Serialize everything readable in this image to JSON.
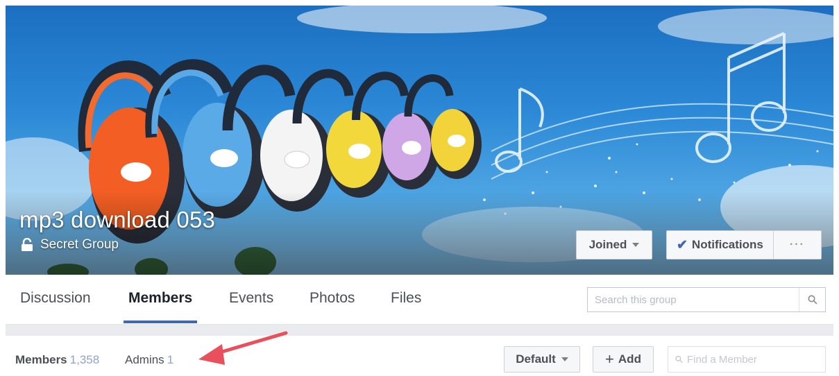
{
  "group": {
    "title": "mp3 download 053",
    "privacy": "Secret Group"
  },
  "cover_buttons": {
    "joined": "Joined",
    "notifications": "Notifications",
    "more": "···"
  },
  "tabs": [
    {
      "label": "Discussion",
      "active": false
    },
    {
      "label": "Members",
      "active": true
    },
    {
      "label": "Events",
      "active": false
    },
    {
      "label": "Photos",
      "active": false
    },
    {
      "label": "Files",
      "active": false
    }
  ],
  "search": {
    "placeholder": "Search this group"
  },
  "members_bar": {
    "members_label": "Members",
    "members_count": "1,358",
    "admins_label": "Admins",
    "admins_count": "1",
    "default_label": "Default",
    "add_label": "Add",
    "find_placeholder": "Find a Member"
  },
  "icons": [
    "lock-icon",
    "check-icon",
    "caret-down-icon",
    "search-icon",
    "plus-icon",
    "magnifier-icon",
    "arrow-annotation-icon"
  ],
  "colors": {
    "accent": "#4267b2",
    "count": "#8ea4cf",
    "annotation_arrow": "#e8505b"
  }
}
